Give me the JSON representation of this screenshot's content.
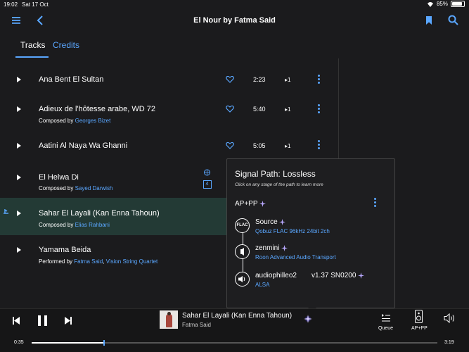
{
  "status": {
    "time": "19:02",
    "date": "Sat 17 Oct",
    "battery": "85%",
    "battery_level": 0.85
  },
  "header": {
    "title": "El Nour  by Fatma Said"
  },
  "tabs": [
    {
      "label": "Tracks"
    },
    {
      "label": "Credits"
    }
  ],
  "tracks": [
    {
      "name": "Ana Bent El Sultan",
      "duration": "2:23",
      "plays": "1"
    },
    {
      "name": "Adieux de l'hôtesse arabe, WD 72",
      "sub_prefix": "Composed by ",
      "sub_link": "Georges Bizet",
      "duration": "5:40",
      "plays": "1"
    },
    {
      "name": "Aatini Al Naya Wa Ghanni",
      "duration": "5:05",
      "plays": "1"
    },
    {
      "name": "El Helwa Di",
      "sub_prefix": "Composed by ",
      "sub_link": "Sayed Darwish",
      "badge": "4"
    },
    {
      "name": "Sahar El Layali (Kan Enna Tahoun)",
      "sub_prefix": "Composed by ",
      "sub_link": "Elias Rahbani"
    },
    {
      "name": "Yamama Beida",
      "sub_prefix": "Performed by ",
      "sub_link": "Fatma Said",
      "sub_sep": ", ",
      "sub_link2": "Vision String Quartet"
    }
  ],
  "signal_path": {
    "title": "Signal Path:",
    "quality": "Lossless",
    "hint": "Click on any stage of the path to learn more",
    "zone": "AP+PP",
    "stages": [
      {
        "icon_text": "FLAC",
        "name": "Source",
        "detail": "Qobuz FLAC 96kHz 24bit 2ch"
      },
      {
        "icon_text": "",
        "name": "zenmini",
        "detail": "Roon Advanced Audio Transport"
      },
      {
        "icon_text": "",
        "name": "audiophilleo2",
        "version": "v1.37 SN0200",
        "detail": "ALSA"
      }
    ]
  },
  "player": {
    "title": "Sahar El Layali (Kan Enna Tahoun)",
    "artist": "Fatma Said",
    "elapsed": "0:35",
    "total": "3:19",
    "progress": 0.176,
    "queue_label": "Queue",
    "zone_label": "AP+PP"
  },
  "colors": {
    "accent": "#5aa7ff",
    "selected_row": "#233a35",
    "background": "#1b1b1d"
  }
}
